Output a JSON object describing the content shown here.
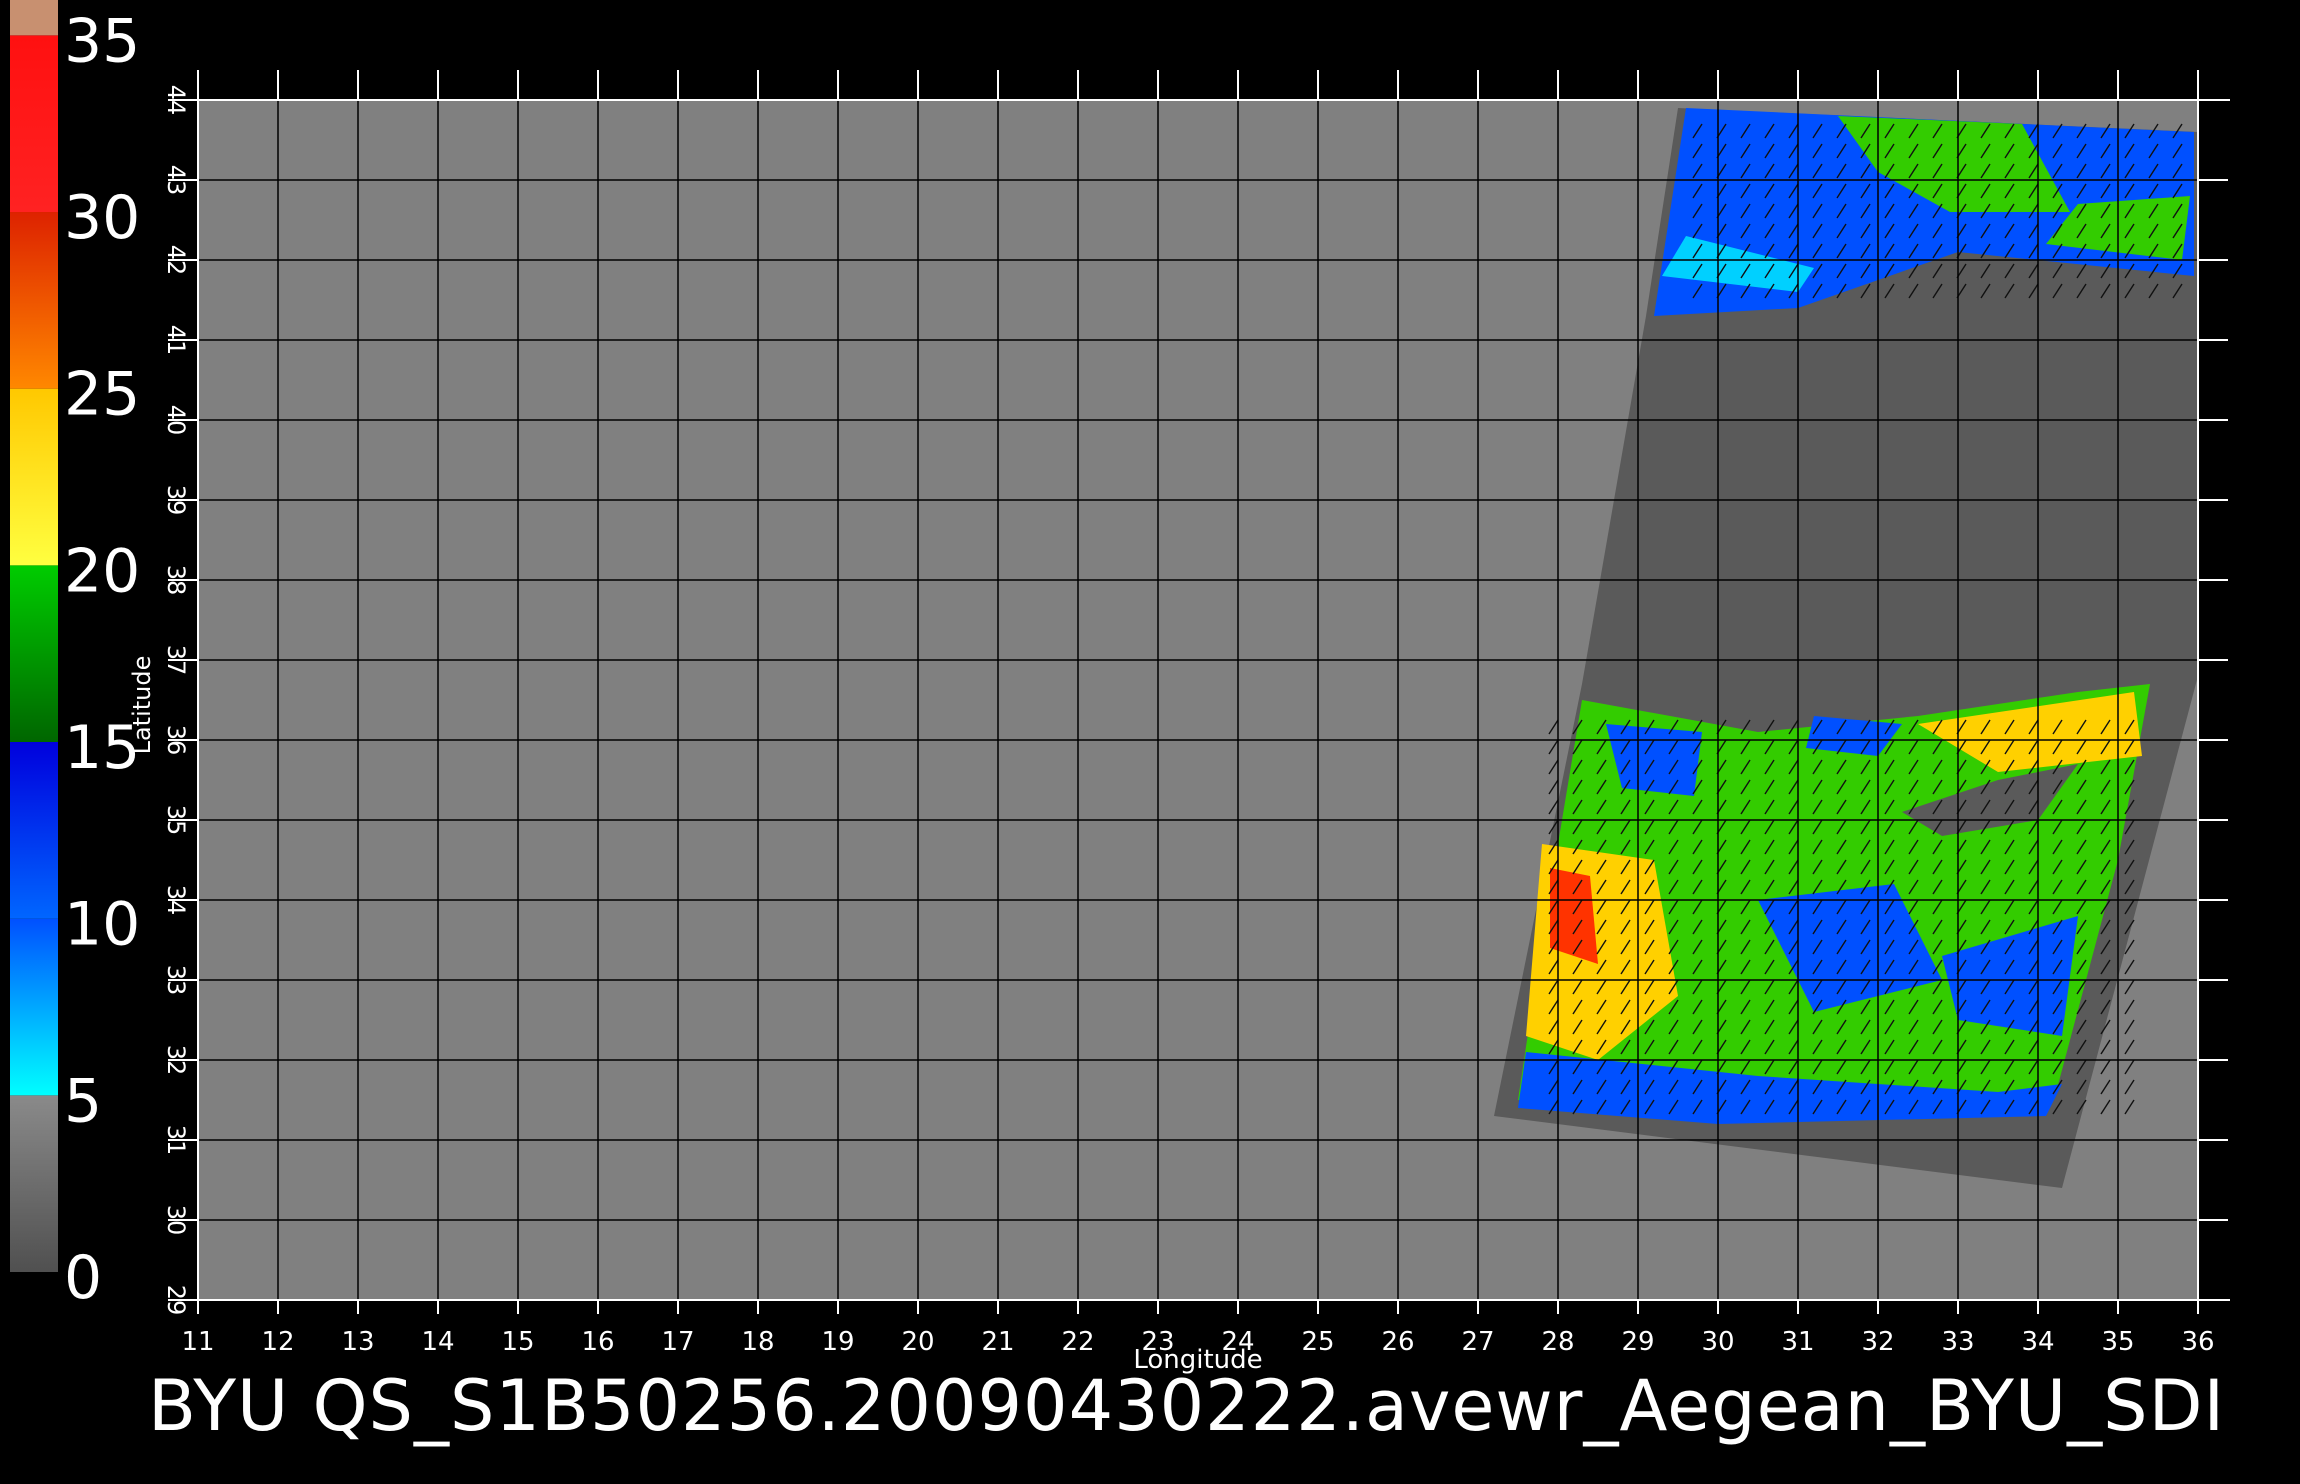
{
  "colorbar": {
    "ticks": [
      "0",
      "5",
      "10",
      "15",
      "20",
      "25",
      "30",
      "35"
    ],
    "stops": [
      {
        "from": 0,
        "to": 5,
        "top": "#8a8a8a",
        "bottom": "#505050"
      },
      {
        "from": 5,
        "to": 10,
        "top": "#0050ff",
        "bottom": "#00ffff"
      },
      {
        "from": 10,
        "to": 15,
        "top": "#0000dd",
        "bottom": "#0066ff"
      },
      {
        "from": 15,
        "to": 20,
        "top": "#00cc00",
        "bottom": "#006600"
      },
      {
        "from": 20,
        "to": 25,
        "top": "#ffc800",
        "bottom": "#ffff40"
      },
      {
        "from": 25,
        "to": 30,
        "top": "#dd2200",
        "bottom": "#ff8800"
      },
      {
        "from": 30,
        "to": 35,
        "top": "#ff1010",
        "bottom": "#ff2222"
      },
      {
        "from": 35,
        "to": 36,
        "top": "#c89070",
        "bottom": "#c89070"
      }
    ]
  },
  "map": {
    "xlabel": "Longitude",
    "ylabel": "Latitude",
    "lon_range": [
      11,
      36
    ],
    "lat_range": [
      29,
      44
    ],
    "lon_ticks": [
      "11",
      "12",
      "13",
      "14",
      "15",
      "16",
      "17",
      "18",
      "19",
      "20",
      "21",
      "22",
      "23",
      "24",
      "25",
      "26",
      "27",
      "28",
      "29",
      "30",
      "31",
      "32",
      "33",
      "34",
      "35",
      "36"
    ],
    "lat_ticks": [
      "29",
      "30",
      "31",
      "32",
      "33",
      "34",
      "35",
      "36",
      "37",
      "38",
      "39",
      "40",
      "41",
      "42",
      "43",
      "44"
    ],
    "background_color": "#808080",
    "grid_color": "#000000",
    "land_color": "#5a5a5a",
    "colors": {
      "low": "#0050ff",
      "mid": "#33cc00",
      "high": "#ffd000",
      "peak": "#ff3300",
      "calm": "#00d0ff"
    }
  },
  "caption": "BYU QS_S1B50256.20090430222.avewr_Aegean_BYU_SDI"
}
